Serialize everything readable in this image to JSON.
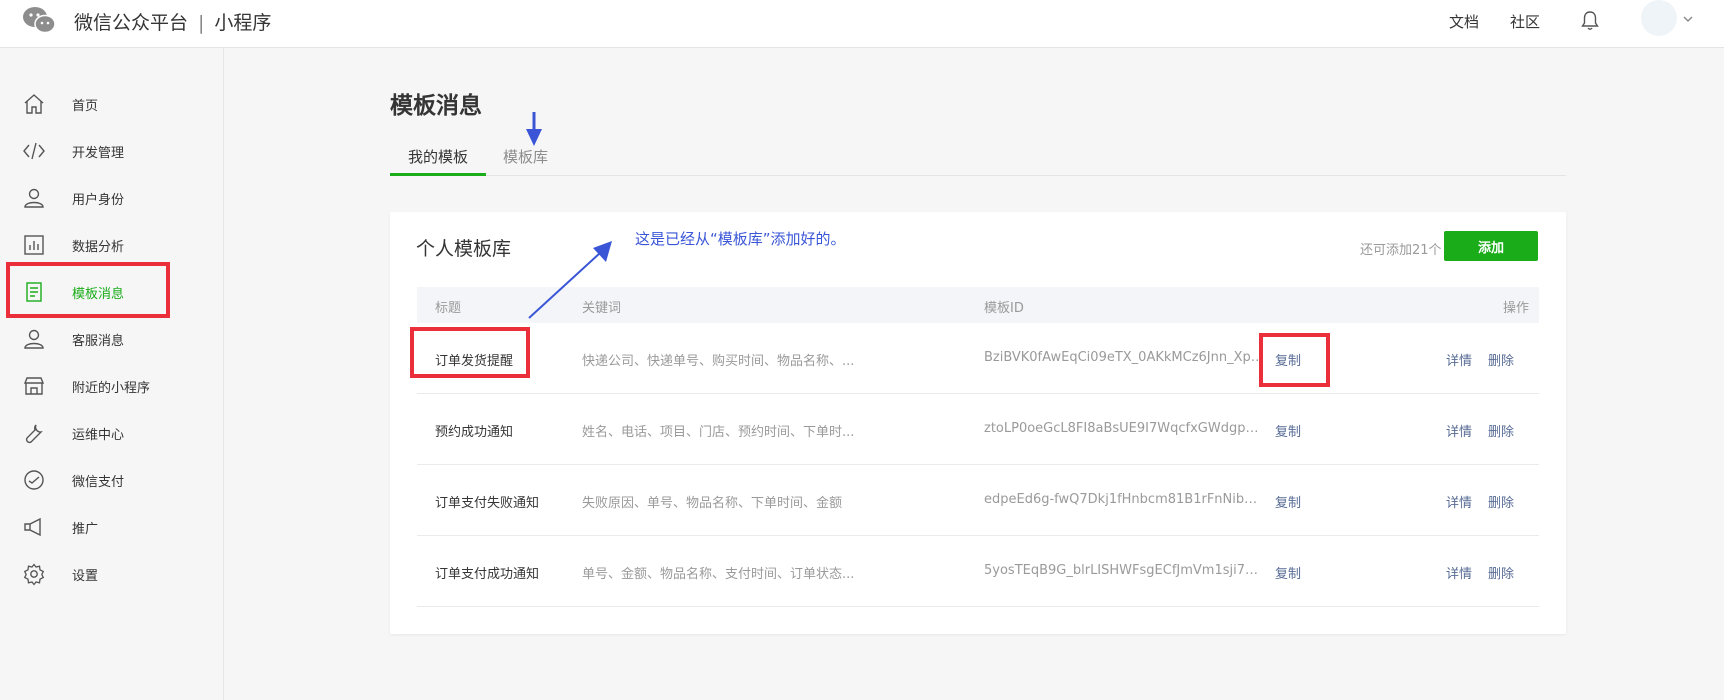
{
  "header": {
    "brand_name": "微信公众平台",
    "brand_separator": "|",
    "brand_product": "小程序",
    "links": [
      "文档",
      "社区"
    ]
  },
  "sidebar": {
    "items": [
      {
        "label": "首页",
        "icon": "home-icon"
      },
      {
        "label": "开发管理",
        "icon": "code-icon"
      },
      {
        "label": "用户身份",
        "icon": "user-icon"
      },
      {
        "label": "数据分析",
        "icon": "chart-icon"
      },
      {
        "label": "模板消息",
        "icon": "document-icon",
        "active": true
      },
      {
        "label": "客服消息",
        "icon": "user-icon"
      },
      {
        "label": "附近的小程序",
        "icon": "store-icon"
      },
      {
        "label": "运维中心",
        "icon": "wrench-icon"
      },
      {
        "label": "微信支付",
        "icon": "payment-icon"
      },
      {
        "label": "推广",
        "icon": "megaphone-icon"
      },
      {
        "label": "设置",
        "icon": "gear-icon"
      }
    ]
  },
  "main": {
    "title": "模板消息",
    "tabs": [
      {
        "label": "我的模板",
        "active": true
      },
      {
        "label": "模板库",
        "active": false
      }
    ]
  },
  "card": {
    "title": "个人模板库",
    "quota": "还可添加21个",
    "add_label": "添加",
    "columns": [
      "标题",
      "关键词",
      "模板ID",
      "操作"
    ],
    "rows": [
      {
        "title": "订单发货提醒",
        "keywords": "快递公司、快递单号、购买时间、物品名称、...",
        "template_id": "BziBVK0fAwEqCi09eTX_0AKkMCz6Jnn_Xpl...",
        "copy": "复制",
        "detail": "详情",
        "delete": "删除"
      },
      {
        "title": "预约成功通知",
        "keywords": "姓名、电话、项目、门店、预约时间、下单时...",
        "template_id": "ztoLP0oeGcL8FI8aBsUE9I7WqcfxGWdgpW...",
        "copy": "复制",
        "detail": "详情",
        "delete": "删除"
      },
      {
        "title": "订单支付失败通知",
        "keywords": "失败原因、单号、物品名称、下单时间、金额",
        "template_id": "edpeEd6g-fwQ7Dkj1fHnbcm81B1rFnNib9c...",
        "copy": "复制",
        "detail": "详情",
        "delete": "删除"
      },
      {
        "title": "订单支付成功通知",
        "keywords": "单号、金额、物品名称、支付时间、订单状态...",
        "template_id": "5yosTEqB9G_blrLISHWFsgECfJmVm1sji73w...",
        "copy": "复制",
        "detail": "详情",
        "delete": "删除"
      }
    ]
  },
  "annotation": {
    "text": "这是已经从“模板库”添加好的。",
    "color": "#3a56d6",
    "highlight_color": "#ea2e3a"
  },
  "colors": {
    "accent": "#1aad19",
    "link": "#576b95"
  }
}
